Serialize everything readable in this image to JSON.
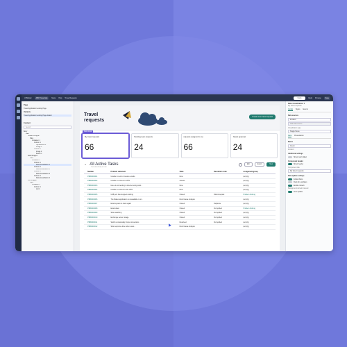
{
  "app": {
    "name": "UI Builder",
    "topbar": [
      "ABC Travel App",
      "Menu",
      "Help",
      "Travel Requests"
    ],
    "top_right": [
      "Undo",
      "Redo",
      "Preview",
      "Save"
    ]
  },
  "left_panel": {
    "pages_heading": "Page",
    "page_value": "Travel Application Landing Page",
    "variants_heading": "Variants",
    "variant_item": "Travel Application Landing Page default",
    "content_heading": "Content",
    "search_placeholder": "Search",
    "tree": [
      "Body",
      "Main",
      "Header Wrapper",
      "Tabs",
      "Container 1",
      "Column 1",
      "Stylized text 1",
      "Image 1",
      "Column 2",
      "Image 2",
      "Button 1",
      "Data Wrapper",
      "Tabs",
      "Container 2",
      "Column 1",
      "Data visualization 1",
      "Column 2",
      "Data visualization 2",
      "Column 3",
      "Data visualization 3",
      "Column 4",
      "Data visualization 4",
      "List Wrapper",
      "Tabs",
      "Container 3",
      "Column 1",
      "List 1"
    ]
  },
  "hero": {
    "title": "Travel requests",
    "button_label": "Create new travel request"
  },
  "cards": [
    {
      "tag": "Data visual",
      "label": "My travel requests",
      "value": "66"
    },
    {
      "tag": "",
      "label": "Pending team requests",
      "value": "24"
    },
    {
      "tag": "",
      "label": "requests assigned to me",
      "value": "66"
    },
    {
      "tag": "",
      "label": "Needs approval",
      "value": "24"
    }
  ],
  "tasks": {
    "title": "All Active Tasks",
    "subtitle": "Last refreshed just now",
    "export_label": "Export",
    "new_label": "New",
    "edit_label": "Edit",
    "columns": [
      "Number",
      "Problem statement",
      "State",
      "Resolution code",
      "Assignment group"
    ],
    "rows": [
      [
        "PRB0000001",
        "Unable to send or receive emails.",
        "New",
        "",
        "(empty)"
      ],
      [
        "PRB0000002",
        "Unable to connect to VPN",
        "Assess",
        "",
        "(empty)"
      ],
      [
        "PRB0000003",
        "Issue is connecting to internet using wirel...",
        "New",
        "",
        "(empty)"
      ],
      [
        "PRB0000004",
        "Unable to connect to the VPN",
        "New",
        "",
        "(empty)"
      ],
      [
        "PRB0000005",
        "USB port has stopped working",
        "Closed",
        "Risk Accepted",
        "Problem Solving"
      ],
      [
        "PRB0000006",
        "The Maileo application is unavailable to ol...",
        "Root Cause Analysis",
        "",
        "(empty)"
      ],
      [
        "PRB0000007",
        "Email system is down again",
        "Closed",
        "Duplicate",
        "(empty)"
      ],
      [
        "PRB0000008",
        "Email down",
        "Closed",
        "Fix Applied",
        "Problem Solving"
      ],
      [
        "PRB0000009",
        "Slow switching",
        "Closed",
        "Fix Applied",
        "(empty)"
      ],
      [
        "PRB0000010",
        "Exchange server outage",
        "Closed",
        "Fix Applied",
        "(empty)"
      ],
      [
        "PRB0000011",
        "Switch occasionally drops connections",
        "Resolved",
        "Fix Applied",
        "(empty)"
      ],
      [
        "PRB0000012",
        "Slow response time when users...",
        "Root Cause Analysis",
        "",
        "(empty)"
      ]
    ]
  },
  "right_panel": {
    "title": "Data visualization 1",
    "subtitle": "My travel requests",
    "tabs": [
      "Config",
      "Styles",
      "Events"
    ],
    "data_sources_label": "Data sources",
    "data_source_value": "Incident",
    "add_label": "Add data source",
    "vis_type_label": "Visualization type",
    "vis_type_value": "Single Score",
    "tabs2": [
      "Data",
      "Presentation"
    ],
    "metric_label": "Metric",
    "metric_value": "Count",
    "metric_source": "Incident",
    "additional_label": "Additional settings",
    "show_metric_label": "Show metric label",
    "header_section": "Component header",
    "show_header": "Show header",
    "header_title_label": "Component title",
    "header_title_value": "My travel requests",
    "auto_label": "Data update settings",
    "follow_since": "Follow filters",
    "real_time": "Real-time updates",
    "enable_refresh": "Enable refresh",
    "bg_refresh": "Background refresh interval",
    "auto_update": "Auto-update"
  },
  "colors": {
    "accent": "#1f7a6e",
    "selection": "#6b5bd6",
    "background": "#6f78db"
  }
}
